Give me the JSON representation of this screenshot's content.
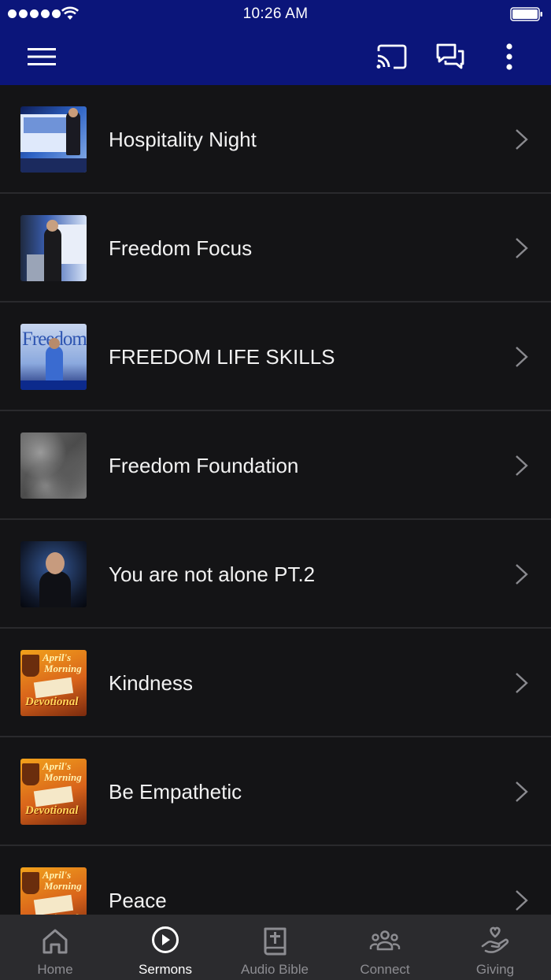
{
  "status_bar": {
    "time": "10:26 AM"
  },
  "app_bar": {
    "menu_icon": "hamburger-menu-icon",
    "cast_icon": "cast-icon",
    "chat_icon": "chat-icon",
    "more_icon": "more-vertical-icon",
    "background": "#0b157a"
  },
  "sermons": [
    {
      "title": "Hospitality Night"
    },
    {
      "title": "Freedom Focus"
    },
    {
      "title": "FREEDOM LIFE SKILLS"
    },
    {
      "title": "Freedom Foundation"
    },
    {
      "title": "You are not alone PT.2"
    },
    {
      "title": "Kindness"
    },
    {
      "title": "Be Empathetic"
    },
    {
      "title": "Peace"
    }
  ],
  "thumb_text": {
    "freedom": "Freedom",
    "devo_1": "April's",
    "devo_2": "Morning",
    "devo_3": "Devotional"
  },
  "tabs": [
    {
      "label": "Home",
      "icon": "home-icon"
    },
    {
      "label": "Sermons",
      "icon": "play-circle-icon"
    },
    {
      "label": "Audio Bible",
      "icon": "bible-icon"
    },
    {
      "label": "Connect",
      "icon": "people-icon"
    },
    {
      "label": "Giving",
      "icon": "giving-hand-heart-icon"
    }
  ],
  "colors": {
    "accent_active": "#ffffff",
    "inactive": "#8d8d92",
    "list_bg": "#141416"
  }
}
